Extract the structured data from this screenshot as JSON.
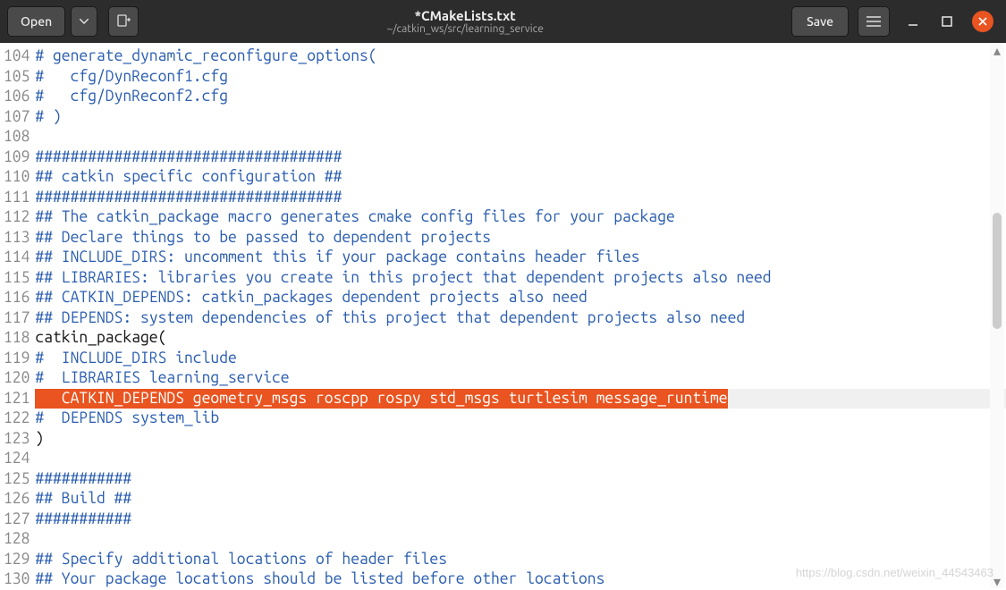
{
  "header": {
    "open_label": "Open",
    "save_label": "Save",
    "title": "*CMakeLists.txt",
    "subtitle": "~/catkin_ws/src/learning_service"
  },
  "lines": [
    {
      "num": "",
      "text": "",
      "cls": "comment",
      "cutoff": true
    },
    {
      "num": "104",
      "text": "# generate_dynamic_reconfigure_options(",
      "cls": "comment"
    },
    {
      "num": "105",
      "text": "#   cfg/DynReconf1.cfg",
      "cls": "comment"
    },
    {
      "num": "106",
      "text": "#   cfg/DynReconf2.cfg",
      "cls": "comment"
    },
    {
      "num": "107",
      "text": "# )",
      "cls": "comment"
    },
    {
      "num": "108",
      "text": "",
      "cls": "comment"
    },
    {
      "num": "109",
      "text": "###################################",
      "cls": "comment"
    },
    {
      "num": "110",
      "text": "## catkin specific configuration ##",
      "cls": "comment"
    },
    {
      "num": "111",
      "text": "###################################",
      "cls": "comment"
    },
    {
      "num": "112",
      "text": "## The catkin_package macro generates cmake config files for your package",
      "cls": "comment"
    },
    {
      "num": "113",
      "text": "## Declare things to be passed to dependent projects",
      "cls": "comment"
    },
    {
      "num": "114",
      "text": "## INCLUDE_DIRS: uncomment this if your package contains header files",
      "cls": "comment"
    },
    {
      "num": "115",
      "text": "## LIBRARIES: libraries you create in this project that dependent projects also need",
      "cls": "comment"
    },
    {
      "num": "116",
      "text": "## CATKIN_DEPENDS: catkin_packages dependent projects also need",
      "cls": "comment"
    },
    {
      "num": "117",
      "text": "## DEPENDS: system dependencies of this project that dependent projects also need",
      "cls": "comment"
    },
    {
      "num": "118",
      "text": "catkin_package(",
      "cls": "code-plain"
    },
    {
      "num": "119",
      "text": "#  INCLUDE_DIRS include",
      "cls": "comment"
    },
    {
      "num": "120",
      "text": "#  LIBRARIES learning_service",
      "cls": "comment"
    },
    {
      "num": "121",
      "text": "   CATKIN_DEPENDS geometry_msgs roscpp rospy std_msgs turtlesim message_runtime",
      "cls": "code-plain",
      "highlight": true
    },
    {
      "num": "122",
      "text": "#  DEPENDS system_lib",
      "cls": "comment"
    },
    {
      "num": "123",
      "text": ")",
      "cls": "code-plain"
    },
    {
      "num": "124",
      "text": "",
      "cls": "comment"
    },
    {
      "num": "125",
      "text": "###########",
      "cls": "comment"
    },
    {
      "num": "126",
      "text": "## Build ##",
      "cls": "comment"
    },
    {
      "num": "127",
      "text": "###########",
      "cls": "comment"
    },
    {
      "num": "128",
      "text": "",
      "cls": "comment"
    },
    {
      "num": "129",
      "text": "## Specify additional locations of header files",
      "cls": "comment"
    },
    {
      "num": "130",
      "text": "## Your package locations should be listed before other locations",
      "cls": "comment",
      "partial": true
    }
  ],
  "watermark": "https://blog.csdn.net/weixin_44543463"
}
